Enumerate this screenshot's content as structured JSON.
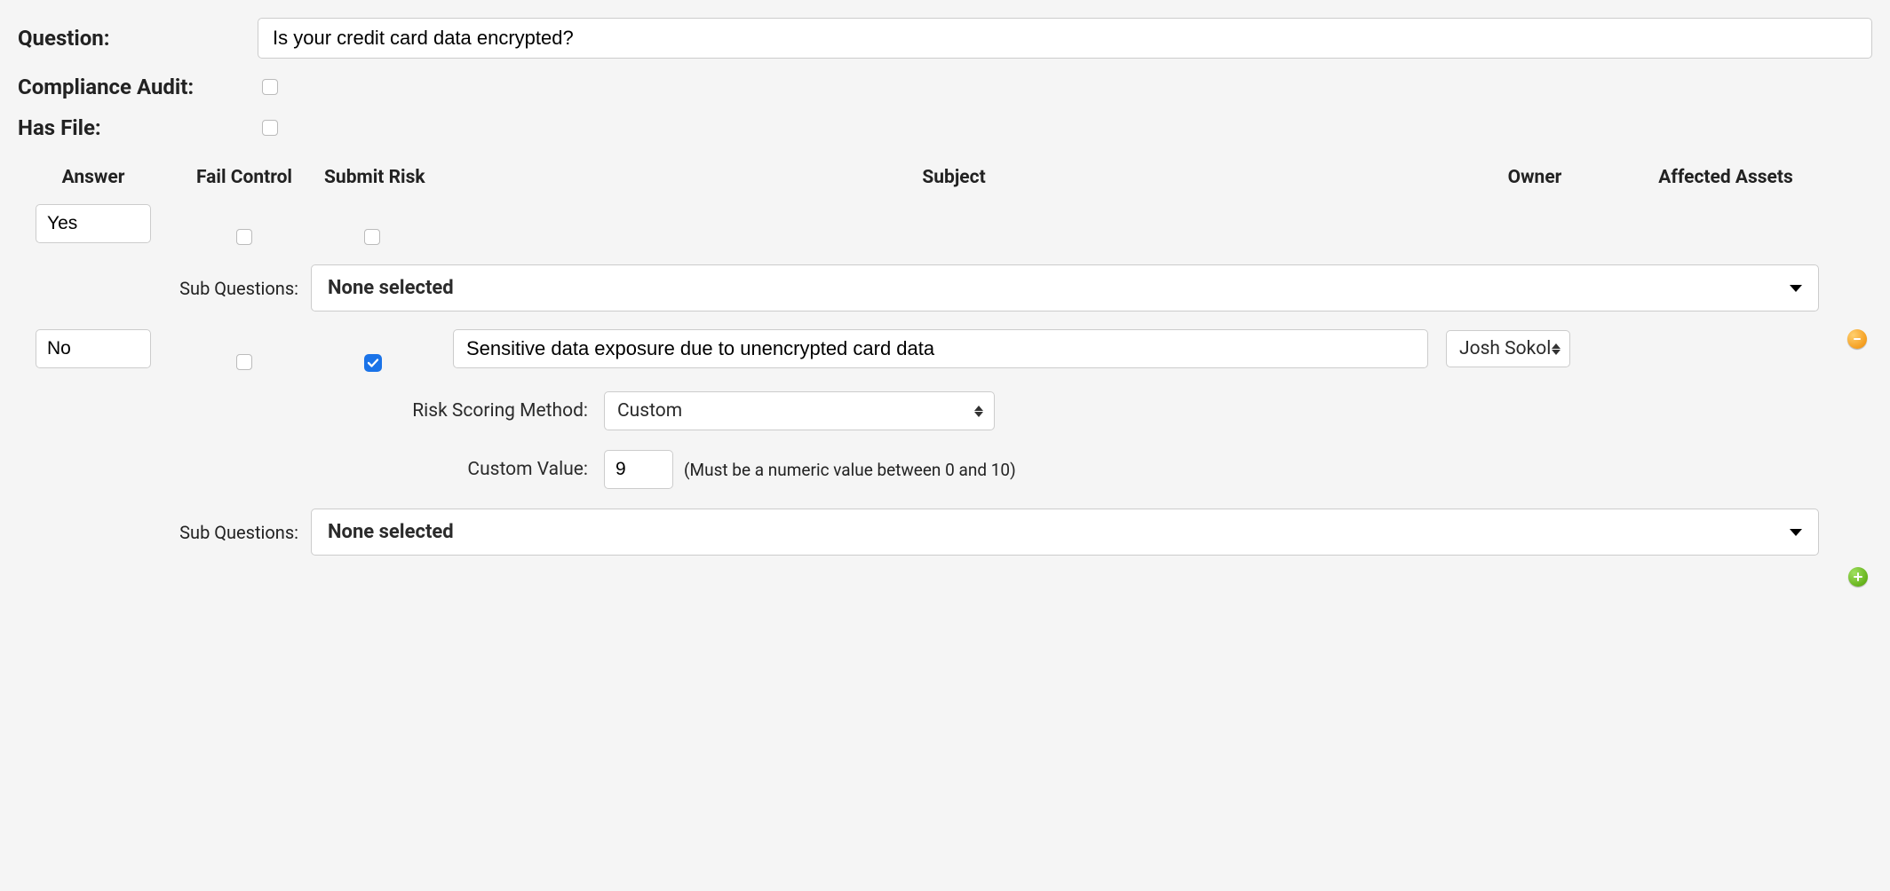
{
  "labels": {
    "question": "Question:",
    "compliance_audit": "Compliance Audit:",
    "has_file": "Has File:",
    "sub_questions": "Sub Questions:",
    "risk_scoring_method": "Risk Scoring Method:",
    "custom_value": "Custom Value:"
  },
  "headers": {
    "answer": "Answer",
    "fail_control": "Fail Control",
    "submit_risk": "Submit Risk",
    "subject": "Subject",
    "owner": "Owner",
    "affected_assets": "Affected Assets"
  },
  "question_text": "Is your credit card data encrypted?",
  "compliance_audit_checked": false,
  "has_file_checked": false,
  "rows": [
    {
      "answer": "Yes",
      "fail_control_checked": false,
      "submit_risk_checked": false,
      "sub_questions_selected": "None selected"
    },
    {
      "answer": "No",
      "fail_control_checked": false,
      "submit_risk_checked": true,
      "subject": "Sensitive data exposure due to unencrypted card data",
      "owner": "Josh Sokol",
      "risk_scoring_method": "Custom",
      "custom_value": "9",
      "custom_hint": "(Must be a numeric value between 0 and 10)",
      "sub_questions_selected": "None selected"
    }
  ]
}
